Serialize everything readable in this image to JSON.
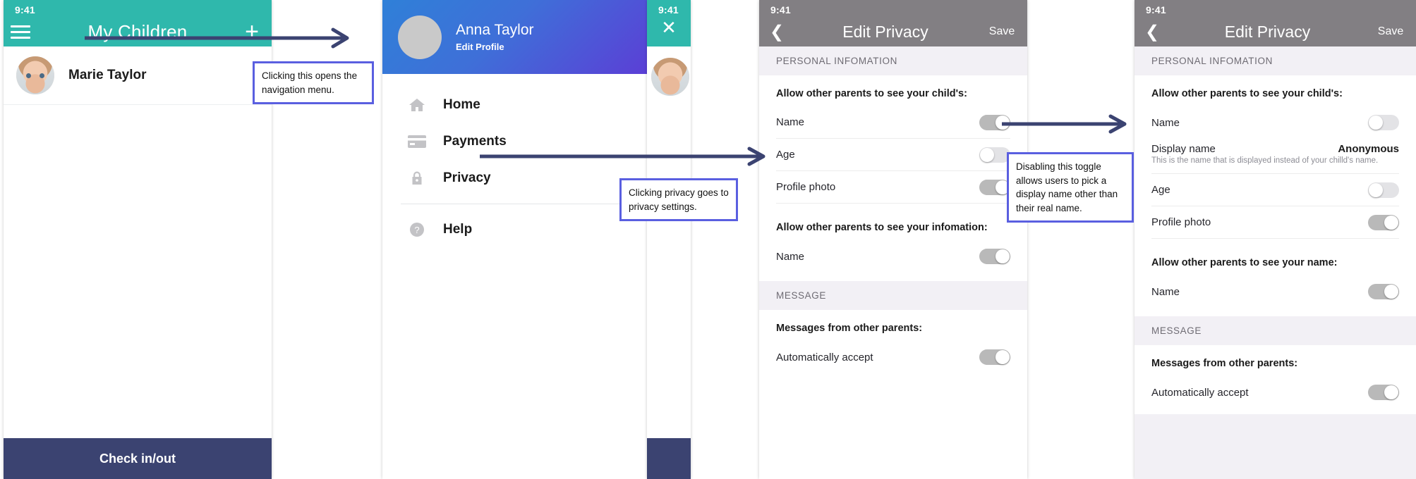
{
  "colors": {
    "teal": "#2fb8ac",
    "navy": "#3b4371",
    "annotation_border": "#5a5fe0",
    "gray_bar": "#827f83",
    "section_bg": "#f2f0f5",
    "gradient_start": "#2f80d8",
    "gradient_end": "#5b3fd6"
  },
  "children_screen": {
    "status_time": "9:41",
    "menu_icon": "hamburger-icon",
    "title": "My Children",
    "add_icon": "plus-icon",
    "children": [
      {
        "name": "Marie Taylor",
        "avatar": "baby-photo"
      }
    ],
    "primary_button": "Check in/out"
  },
  "drawer_screen": {
    "user_name": "Anna Taylor",
    "edit_profile": "Edit Profile",
    "avatar": "user-avatar",
    "items": [
      {
        "label": "Home",
        "icon": "home-icon"
      },
      {
        "label": "Payments",
        "icon": "credit-card-icon"
      },
      {
        "label": "Privacy",
        "icon": "lock-icon"
      },
      {
        "label": "Help",
        "icon": "question-circle-icon"
      }
    ],
    "peek": {
      "status_time": "9:41",
      "close_icon": "close-icon"
    }
  },
  "privacy_before": {
    "status_time": "9:41",
    "back_icon": "chevron-left-icon",
    "title": "Edit Privacy",
    "save_label": "Save",
    "sections": [
      {
        "header": "PERSONAL INFOMATION",
        "groups": [
          {
            "title": "Allow other parents to see your child's:",
            "rows": [
              {
                "label": "Name",
                "toggle": "on"
              },
              {
                "label": "Age",
                "toggle": "off"
              },
              {
                "label": "Profile photo",
                "toggle": "on"
              }
            ]
          },
          {
            "title": "Allow other parents to see your infomation:",
            "rows": [
              {
                "label": "Name",
                "toggle": "on"
              }
            ]
          }
        ]
      },
      {
        "header": "MESSAGE",
        "groups": [
          {
            "title": "Messages from other parents:",
            "rows": [
              {
                "label": "Automatically accept",
                "toggle": "on"
              }
            ]
          }
        ]
      }
    ]
  },
  "privacy_after": {
    "status_time": "9:41",
    "back_icon": "chevron-left-icon",
    "title": "Edit Privacy",
    "save_label": "Save",
    "section_header_1": "PERSONAL INFOMATION",
    "group1_title": "Allow other parents to see your child's:",
    "name_label": "Name",
    "name_toggle": "off",
    "display_name_label": "Display name",
    "display_name_value": "Anonymous",
    "display_name_help": "This is the name that is displayed instead of your chilld's name.",
    "age_label": "Age",
    "age_toggle": "off",
    "photo_label": "Profile photo",
    "photo_toggle": "on",
    "group2_title": "Allow other parents to see your name:",
    "group2_row_label": "Name",
    "group2_row_toggle": "on",
    "section_header_2": "MESSAGE",
    "group3_title": "Messages from other parents:",
    "group3_row_label": "Automatically accept",
    "group3_row_toggle": "on"
  },
  "annotations": [
    {
      "id": "nav-menu-note",
      "text": "Clicking this opens the navigation menu."
    },
    {
      "id": "privacy-note",
      "text": "Clicking privacy goes to privacy settings."
    },
    {
      "id": "toggle-note",
      "text": "Disabling this toggle allows users to pick a display name other than their real name."
    }
  ]
}
